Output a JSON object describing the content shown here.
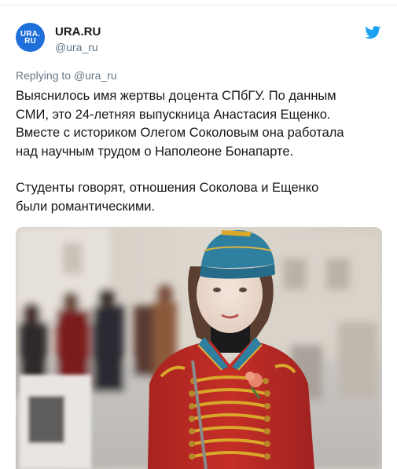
{
  "author": {
    "avatar_line1": "URA.",
    "avatar_line2": "RU",
    "name": "URA.RU",
    "handle": "@ura_ru"
  },
  "reply": {
    "prefix": "Replying to",
    "mention": "@ura_ru"
  },
  "tweet": {
    "line1": "Выяснилось имя жертвы доцента СПбГУ. По данным",
    "line2": "СМИ, это 24-летняя выпускница Анастасия Ещенко.",
    "line3": "Вместе с историком Олегом Соколовым она работала",
    "line4": "над научным трудом о Наполеоне Бонапарте.",
    "line5": "Студенты говорят, отношения Соколова и Ещенко",
    "line6": "были романтическими."
  },
  "icons": {
    "platform": "twitter-bird-icon"
  },
  "colors": {
    "brand_blue": "#1da1f2",
    "avatar_blue": "#1e6fd9",
    "secondary_text": "#657786"
  }
}
